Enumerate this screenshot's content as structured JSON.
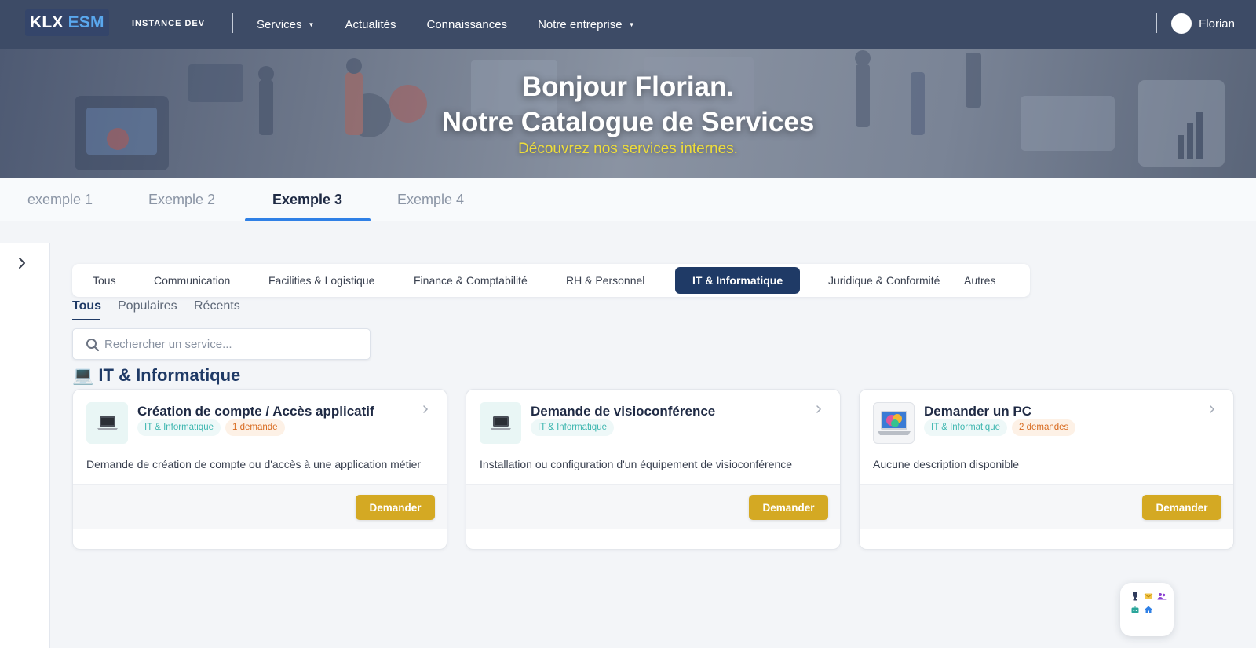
{
  "header": {
    "logo_primary": "KLX",
    "logo_secondary": "ESM",
    "instance_label": "INSTANCE DEV",
    "nav": [
      {
        "label": "Services",
        "has_dropdown": true
      },
      {
        "label": "Actualités",
        "has_dropdown": false
      },
      {
        "label": "Connaissances",
        "has_dropdown": false
      },
      {
        "label": "Notre entreprise",
        "has_dropdown": true
      }
    ],
    "user_name": "Florian"
  },
  "hero": {
    "greeting": "Bonjour Florian.",
    "title": "Notre Catalogue de Services",
    "subtitle": "Découvrez nos services internes."
  },
  "page_tabs": {
    "items": [
      "exemple 1",
      "Exemple 2",
      "Exemple 3",
      "Exemple 4"
    ],
    "active": "Exemple 3"
  },
  "categories": {
    "items": [
      "Tous",
      "Communication",
      "Facilities & Logistique",
      "Finance & Comptabilité",
      "RH & Personnel",
      "IT & Informatique",
      "Juridique & Conformité",
      "Autres"
    ],
    "active": "IT & Informatique"
  },
  "filter_tabs": {
    "items": [
      "Tous",
      "Populaires",
      "Récents"
    ],
    "active": "Tous"
  },
  "search": {
    "placeholder": "Rechercher un service...",
    "value": ""
  },
  "section": {
    "emoji": "💻",
    "title": "IT & Informatique"
  },
  "cards": [
    {
      "title": "Création de compte / Accès applicatif",
      "category": "IT & Informatique",
      "count": "1 demande",
      "description": "Demande de création de compte ou d'accès à une application métier",
      "button": "Demander",
      "icon": "laptop-icon"
    },
    {
      "title": "Demande de visioconférence",
      "category": "IT & Informatique",
      "count": "",
      "description": "Installation ou configuration d'un équipement de visioconférence",
      "button": "Demander",
      "icon": "laptop-icon"
    },
    {
      "title": "Demander un PC",
      "category": "IT & Informatique",
      "count": "2 demandes",
      "description": "Aucune description disponible",
      "button": "Demander",
      "icon": "laptop-photo"
    }
  ],
  "colors": {
    "navbar": "#3d4b66",
    "accent_blue": "#2f80e6",
    "category_active": "#1f3a66",
    "button": "#d4a923",
    "hero_subtitle": "#eedd3a",
    "tag_teal": "#3fb7b0",
    "tag_orange": "#d86a1e"
  },
  "floating_widget": {
    "icons": [
      "trophy-icon",
      "mail-icon",
      "users-icon",
      "bot-icon",
      "home-icon"
    ]
  }
}
